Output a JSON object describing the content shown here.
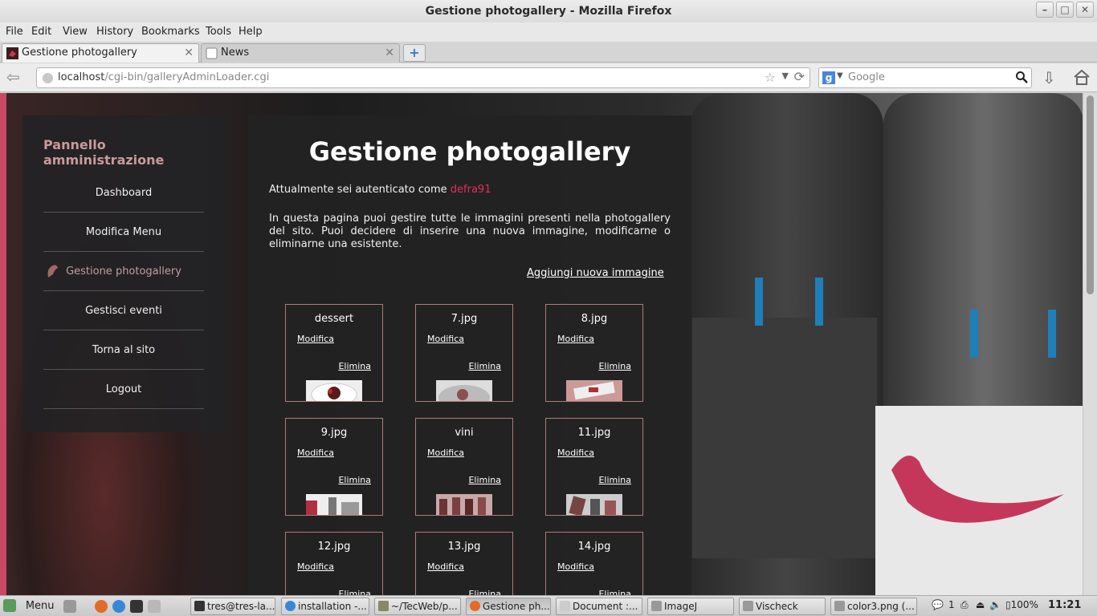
{
  "window": {
    "title": "Gestione photogallery - Mozilla Firefox"
  },
  "menu": [
    "File",
    "Edit",
    "View",
    "History",
    "Bookmarks",
    "Tools",
    "Help"
  ],
  "tabs": [
    {
      "label": "Gestione photogallery",
      "active": true
    },
    {
      "label": "News",
      "active": false
    }
  ],
  "nav": {
    "url_host": "localhost",
    "url_path": "/cgi-bin/galleryAdminLoader.cgi",
    "search_placeholder": "Google"
  },
  "sidebar": {
    "title": "Pannello amministrazione",
    "items": [
      "Dashboard",
      "Modifica Menu",
      "Gestione photogallery",
      "Gestisci eventi",
      "Torna al sito",
      "Logout"
    ]
  },
  "main": {
    "heading": "Gestione photogallery",
    "auth_prefix": "Attualmente sei autenticato come",
    "username": "defra91",
    "description": "In questa pagina puoi gestire tutte le immagini presenti nella photogallery del sito. Puoi decidere di inserire una nuova immagine, modificarne o eliminarne una esistente.",
    "add_link": "Aggiungi nuova immagine",
    "edit_label": "Modifica",
    "delete_label": "Elimina",
    "images": [
      "dessert",
      "7.jpg",
      "8.jpg",
      "9.jpg",
      "vini",
      "11.jpg",
      "12.jpg",
      "13.jpg",
      "14.jpg"
    ]
  },
  "taskbar": {
    "menu_label": "Menu",
    "windows": [
      "tres@tres-la...",
      "installation -...",
      "~/TecWeb/p...",
      "Gestione ph...",
      "Document :...",
      "ImageJ",
      "Vischeck",
      "color3.png (..."
    ],
    "tray_count": "1",
    "battery": "100%",
    "clock": "11:21"
  },
  "colors": {
    "accent_user": "#e0305a",
    "sidebar_title": "#c99a9a",
    "card_border": "#b07a7a"
  }
}
